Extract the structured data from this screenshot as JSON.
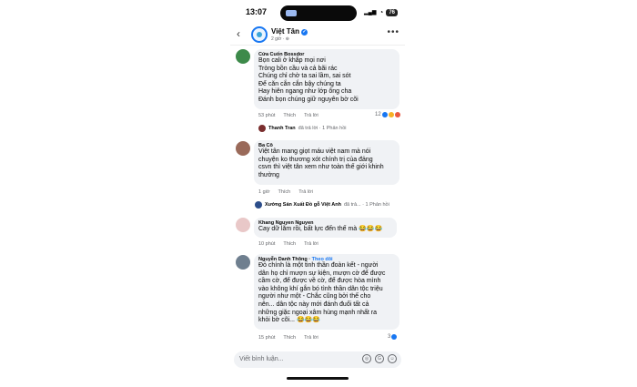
{
  "status": {
    "time": "13:07",
    "battery": "76"
  },
  "header": {
    "page_name": "Việt Tân",
    "subtitle": "2 giờ · ⊕"
  },
  "comments": [
    {
      "author": "Cửa Cuốn Bossdor",
      "lines": [
        "Bọn cali ở khắp mọi nơi",
        "Tròng bồn cầu và cả bãi rác",
        "Chúng chỉ chờ ta sai lầm, sai sót",
        "Để căn cắn cắn bậy chúng ta",
        "Hay hiên ngang như lớp ông cha",
        "Đánh bọn chúng giữ nguyên bờ cõi"
      ],
      "time": "53 phút",
      "like": "Thích",
      "reply": "Trả lời",
      "reactions": "12",
      "reply_author": "Thanh Tran",
      "reply_text": "đã trả lời · 1 Phản hồi"
    },
    {
      "author": "Ba Cô",
      "lines": [
        "Việt tân mang giọt máu việt nam mà nói",
        "chuyện ko thương xót chính trị của đảng",
        "csvn thì việt tân xem như toàn thế giới khinh",
        "thường"
      ],
      "time": "1 giờ",
      "like": "Thích",
      "reply": "Trả lời",
      "reply_author": "Xưởng Sản Xuất Đồ gỗ Việt Anh",
      "reply_text": "đã trả... · 1 Phản hồi"
    },
    {
      "author": "Khang Nguyen Nguyen",
      "lines": [
        "Cay dữ lắm rồi, bất lực đến thế mà 😂😂😂"
      ],
      "time": "10 phút",
      "like": "Thích",
      "reply": "Trả lời"
    },
    {
      "author": "Nguyễn Danh Thông",
      "follow": "Theo dõi",
      "lines": [
        "Đó chính là một tinh thần đoàn kết - người",
        "dân họ chỉ mượn sự kiện, mượn cờ để được",
        "cầm cờ, để được về cờ, để được hòa mình",
        "vào không khí gắn bó tình thần dân tộc triệu",
        "người như một - Chắc cũng bởi thế cho",
        "nên... dân tộc này mới đánh đuổi tất cả",
        "những giặc ngoại xâm hùng mạnh nhất ra",
        "khỏi bờ cõi... 😂😂😂"
      ],
      "time": "15 phút",
      "like": "Thích",
      "reply": "Trả lời",
      "reactions": "3"
    }
  ],
  "composer": {
    "placeholder": "Viết bình luận..."
  },
  "colors": {
    "accent": "#1877f2",
    "bubble": "#f0f2f5"
  }
}
